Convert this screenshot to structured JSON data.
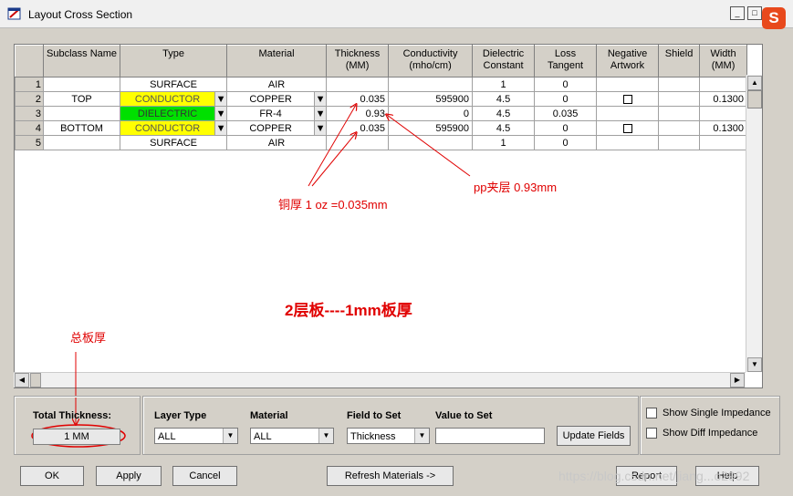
{
  "window": {
    "title": "Layout Cross Section",
    "min_label": "_",
    "max_label": "□",
    "close_label": "×",
    "ime_label": "S"
  },
  "grid": {
    "headers": [
      {
        "line1": "",
        "line2": ""
      },
      {
        "line1": "Subclass Name",
        "line2": ""
      },
      {
        "line1": "Type",
        "line2": ""
      },
      {
        "line1": "Material",
        "line2": ""
      },
      {
        "line1": "Thickness",
        "line2": "(MM)"
      },
      {
        "line1": "Conductivity",
        "line2": "(mho/cm)"
      },
      {
        "line1": "Dielectric",
        "line2": "Constant"
      },
      {
        "line1": "Loss",
        "line2": "Tangent"
      },
      {
        "line1": "Negative",
        "line2": "Artwork"
      },
      {
        "line1": "Shield",
        "line2": ""
      },
      {
        "line1": "Width",
        "line2": "(MM)"
      }
    ],
    "rows": [
      {
        "num": "1",
        "subclass": "",
        "type": "SURFACE",
        "material": "AIR",
        "thickness": "",
        "conductivity": "",
        "dielectric": "1",
        "loss": "0",
        "width": ""
      },
      {
        "num": "2",
        "subclass": "TOP",
        "type": "CONDUCTOR",
        "material": "COPPER",
        "thickness": "0.035",
        "conductivity": "595900",
        "dielectric": "4.5",
        "loss": "0",
        "width": "0.1300"
      },
      {
        "num": "3",
        "subclass": "",
        "type": "DIELECTRIC",
        "material": "FR-4",
        "thickness": "0.93",
        "conductivity": "0",
        "dielectric": "4.5",
        "loss": "0.035",
        "width": ""
      },
      {
        "num": "4",
        "subclass": "BOTTOM",
        "type": "CONDUCTOR",
        "material": "COPPER",
        "thickness": "0.035",
        "conductivity": "595900",
        "dielectric": "4.5",
        "loss": "0",
        "width": "0.1300"
      },
      {
        "num": "5",
        "subclass": "",
        "type": "SURFACE",
        "material": "AIR",
        "thickness": "",
        "conductivity": "",
        "dielectric": "1",
        "loss": "0",
        "width": ""
      }
    ]
  },
  "annotations": {
    "copper": "铜厚 1 oz =0.035mm",
    "pp": "pp夹层  0.93mm",
    "board": "2层板----1mm板厚",
    "total": "总板厚"
  },
  "bottom": {
    "total_label": "Total Thickness:",
    "total_value": "1 MM",
    "layer_type_label": "Layer Type",
    "layer_type_value": "ALL",
    "material_label": "Material",
    "material_value": "ALL",
    "field_label": "Field to Set",
    "field_value": "Thickness",
    "value_label": "Value to Set",
    "value_value": "",
    "update_button": "Update Fields",
    "single_impedance": "Show Single Impedance",
    "diff_impedance": "Show Diff Impedance"
  },
  "buttons": {
    "ok": "OK",
    "apply": "Apply",
    "cancel": "Cancel",
    "refresh": "Refresh Materials ->",
    "report": "Report",
    "help": "Help"
  },
  "watermark": "https://blog.csdn.net/jiang...o2992",
  "colors": {
    "conductor": "#ffff00",
    "dielectric": "#00e000",
    "annotation": "#e00000"
  }
}
